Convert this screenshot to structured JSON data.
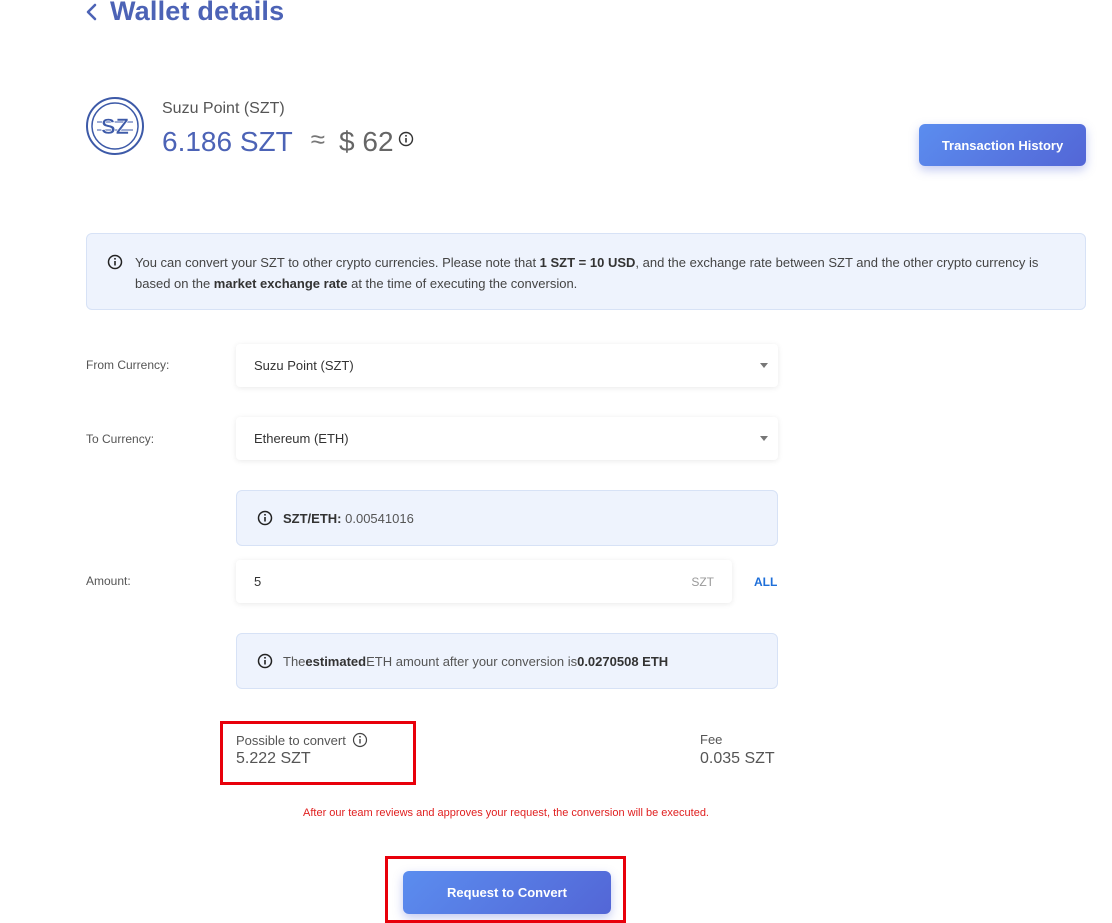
{
  "header": {
    "title": "Wallet details"
  },
  "balance": {
    "coin_name": "Suzu Point (SZT)",
    "amount": "6.186 SZT",
    "approx_symbol": "≈",
    "usd": "$ 62"
  },
  "history_button": "Transaction History",
  "notice": {
    "part1": "You can convert your SZT to other crypto currencies. Please note that ",
    "bold1": "1 SZT = 10 USD",
    "part2": ", and the exchange rate between SZT and the other crypto currency is based on the ",
    "bold2": "market exchange rate",
    "part3": " at the time of executing the conversion."
  },
  "form": {
    "from_label": "From Currency:",
    "from_value": "Suzu Point (SZT)",
    "to_label": "To Currency:",
    "to_value": "Ethereum (ETH)",
    "rate_label": "SZT/ETH:",
    "rate_value": "0.00541016",
    "amount_label": "Amount:",
    "amount_value": "5",
    "amount_unit": "SZT",
    "all_label": "ALL",
    "estimate": {
      "part1": "The ",
      "bold1": "estimated",
      "part2": " ETH amount after your conversion is ",
      "bold2": "0.0270508 ETH"
    },
    "possible_label": "Possible to convert",
    "possible_value": "5.222 SZT",
    "fee_label": "Fee",
    "fee_value": "0.035 SZT"
  },
  "warning": "After our team reviews and approves your request, the conversion will be executed.",
  "convert_button": "Request to Convert",
  "colors": {
    "accent": "#4c63b6",
    "button": "#5366d6",
    "notice_bg": "#eef3fd",
    "warning": "#e02020",
    "highlight": "#e8000b"
  }
}
